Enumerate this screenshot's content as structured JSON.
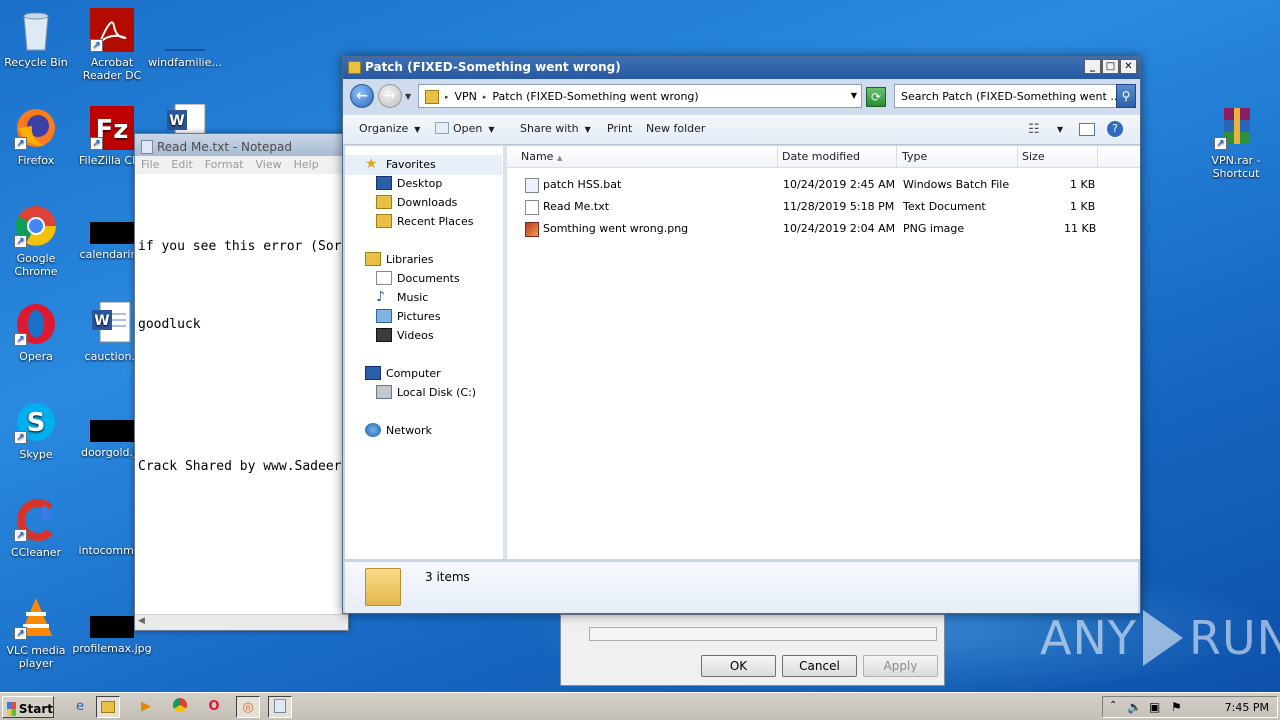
{
  "desktop_icons": [
    {
      "label": "Recycle Bin"
    },
    {
      "label": "Acrobat Reader DC"
    },
    {
      "label": "windfamilie..."
    },
    {
      "label": "Firefox"
    },
    {
      "label": "FileZilla Clie"
    },
    {
      "label": "Google Chrome"
    },
    {
      "label": "calendarind"
    },
    {
      "label": "Opera"
    },
    {
      "label": "cauction.r"
    },
    {
      "label": "Skype"
    },
    {
      "label": "doorgold.jp"
    },
    {
      "label": "CCleaner"
    },
    {
      "label": "intocommitt"
    },
    {
      "label": "VLC media player"
    },
    {
      "label": "profilemax.jpg"
    },
    {
      "label": "VPN.rar - Shortcut"
    }
  ],
  "notepad": {
    "title": "Read Me.txt - Notepad",
    "menu": [
      "File",
      "Edit",
      "Format",
      "View",
      "Help"
    ],
    "lines": [
      "if you see this error (Sor",
      "goodluck",
      "",
      "Crack Shared by www.Sadeer"
    ]
  },
  "dialog": {
    "ok_label": "OK",
    "cancel_label": "Cancel",
    "apply_label": "Apply"
  },
  "explorer": {
    "title": "Patch (FIXED-Something went wrong)",
    "breadcrumb": [
      "VPN",
      "Patch (FIXED-Something went wrong)"
    ],
    "search_placeholder": "Search Patch (FIXED-Something went ...",
    "toolbar": {
      "organize": "Organize",
      "open": "Open",
      "share_with": "Share with",
      "print": "Print",
      "new_folder": "New folder"
    },
    "nav": {
      "favorites": "Favorites",
      "desktop": "Desktop",
      "downloads": "Downloads",
      "recent_places": "Recent Places",
      "libraries": "Libraries",
      "documents": "Documents",
      "music": "Music",
      "pictures": "Pictures",
      "videos": "Videos",
      "computer": "Computer",
      "local_disk": "Local Disk (C:)",
      "network": "Network"
    },
    "columns": {
      "name": "Name",
      "date_modified": "Date modified",
      "type": "Type",
      "size": "Size"
    },
    "files": [
      {
        "name": "patch HSS.bat",
        "date": "10/24/2019 2:45 AM",
        "type": "Windows Batch File",
        "size": "1 KB"
      },
      {
        "name": "Read Me.txt",
        "date": "11/28/2019 5:18 PM",
        "type": "Text Document",
        "size": "1 KB"
      },
      {
        "name": "Somthing went wrong.png",
        "date": "10/24/2019 2:04 AM",
        "type": "PNG image",
        "size": "11 KB"
      }
    ],
    "item_count": "3 items"
  },
  "watermark": {
    "left": "ANY",
    "right": "RUN"
  },
  "taskbar": {
    "start_label": "Start",
    "clock": "7:45 PM"
  }
}
